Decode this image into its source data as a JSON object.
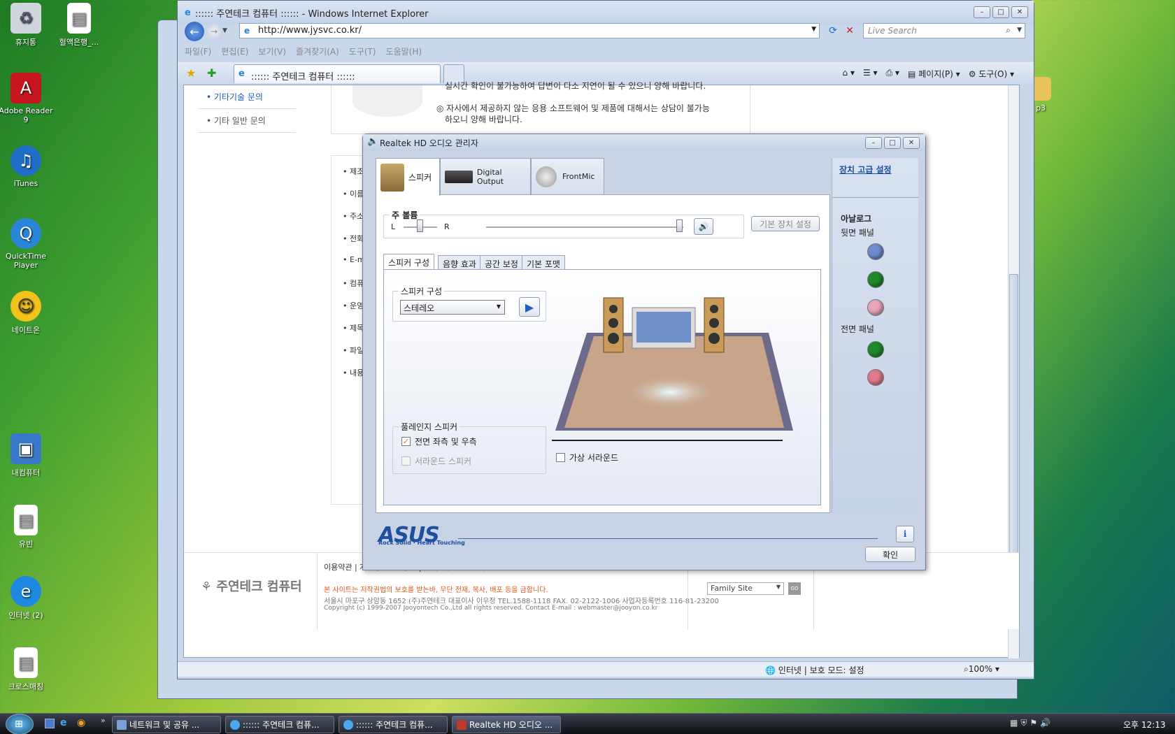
{
  "desktop": {
    "icons": [
      {
        "label": "휴지통",
        "icon": "recycle-bin-icon"
      },
      {
        "label": "혈액은행_...",
        "icon": "document-icon"
      },
      {
        "label": "Adobe Reader 9",
        "icon": "pdf-icon",
        "color": "#c4161c"
      },
      {
        "label": "iTunes",
        "icon": "music-icon",
        "color": "#1f6fc8"
      },
      {
        "label": "QuickTime Player",
        "icon": "quicktime-icon",
        "color": "#2a86d9"
      },
      {
        "label": "네이트온",
        "icon": "messenger-icon",
        "color": "#f1c21b"
      },
      {
        "label": "내컴퓨터",
        "icon": "computer-icon",
        "color": "#3a78c9"
      },
      {
        "label": "유빈",
        "icon": "document-icon"
      },
      {
        "label": "인터넷 (2)",
        "icon": "ie-icon",
        "color": "#1f88e0"
      },
      {
        "label": "크로스매칭",
        "icon": "document-icon"
      },
      {
        "label": "p3",
        "icon": "folder-icon"
      }
    ]
  },
  "ie": {
    "title": ":::::: 주연테크 컴퓨터 :::::: - Windows Internet Explorer",
    "url": "http://www.jysvc.co.kr/",
    "search_placeholder": "Live Search",
    "menu": [
      "파일(F)",
      "편집(E)",
      "보기(V)",
      "즐겨찾기(A)",
      "도구(T)",
      "도움말(H)"
    ],
    "tab_label": ":::::: 주연테크 컴퓨터 ::::::",
    "tools": {
      "page": "페이지(P)",
      "tools": "도구(O)"
    },
    "sidenav": [
      "기타기술 문의",
      "기타 일반 문의"
    ],
    "notice_line1": "실시간 확인이 불가능하여 답변이 다소 지연이 될 수 있으니 양해 바랍니다.",
    "notice_line2": "자사에서 제공하지 않는 응용 소프트웨어 및 제품에 대해서는 상담이 불가능",
    "notice_line3": "하오니 양해 바랍니다.",
    "form_labels": [
      "제조",
      "이름",
      "주소",
      "전화",
      "E-m",
      "컴퓨",
      "운영",
      "제목",
      "파일",
      "내용"
    ],
    "footer": {
      "links": "이용약관  |  개인정보취급방침  |  이메일무단수집거부",
      "logo": "주연테크 컴퓨터",
      "warning": "본 사이트는 저작권법의 보호를 받는바, 무단 전재, 복사, 배포 등을 금합니다.",
      "address": "서울시 마포구 상암동 1652 (주)주연테크 대표이사 이우정  TEL.1588-1118  FAX. 02-2122-1006   사업자등록번호 116-81-23200",
      "copyright": "Copyright (c) 1999-2007 Jooyontech Co.,Ltd all rights reserved.    Contact E-mail : webmaster@jooyon.co.kr",
      "family_site": "Family Site",
      "go": "GO"
    },
    "status": {
      "zone": "인터넷 | 보호 모드: 설정",
      "zoom": "100%"
    }
  },
  "realtek": {
    "title": "Realtek HD 오디오 관리자",
    "tabs": [
      "스피커",
      "Digital Output",
      "FrontMic"
    ],
    "advanced_link": "장치 고급 설정",
    "main_volume_label": "주 볼륨",
    "balance_left": "L",
    "balance_right": "R",
    "default_device_button": "기본 장치 설정",
    "subtabs": [
      "스피커 구성",
      "음향 효과",
      "공간 보정",
      "기본 포맷"
    ],
    "speaker_config_label": "스피커 구성",
    "speaker_config_value": "스테레오",
    "fullrange_label": "풀레인지 스피커",
    "front_lr": "전면 좌측 및 우측",
    "surround_speakers": "서라운드 스피커",
    "virtual_surround": "가상 서라운드",
    "analog_title": "아날로그",
    "rear_panel": "뒷면 패널",
    "front_panel": "전면 패널",
    "jacks_rear_colors": [
      "#6f8ccf",
      "#1f8a2a",
      "#e9a6b8"
    ],
    "jacks_front_colors": [
      "#1f8a2a",
      "#e07a8f"
    ],
    "asus_logo": "ASUS",
    "asus_slogan": "Rock Solid · Heart Touching",
    "ok_button": "확인",
    "info_icon": "i"
  },
  "taskbar": {
    "quick": [
      "show-desktop-icon",
      "ie-icon",
      "media-icon"
    ],
    "items": [
      "네트워크 및 공유 ...",
      ":::::: 주연테크 컴퓨...",
      ":::::: 주연테크 컴퓨...",
      "Realtek HD 오디오 ..."
    ],
    "clock": "오후 12:13"
  }
}
